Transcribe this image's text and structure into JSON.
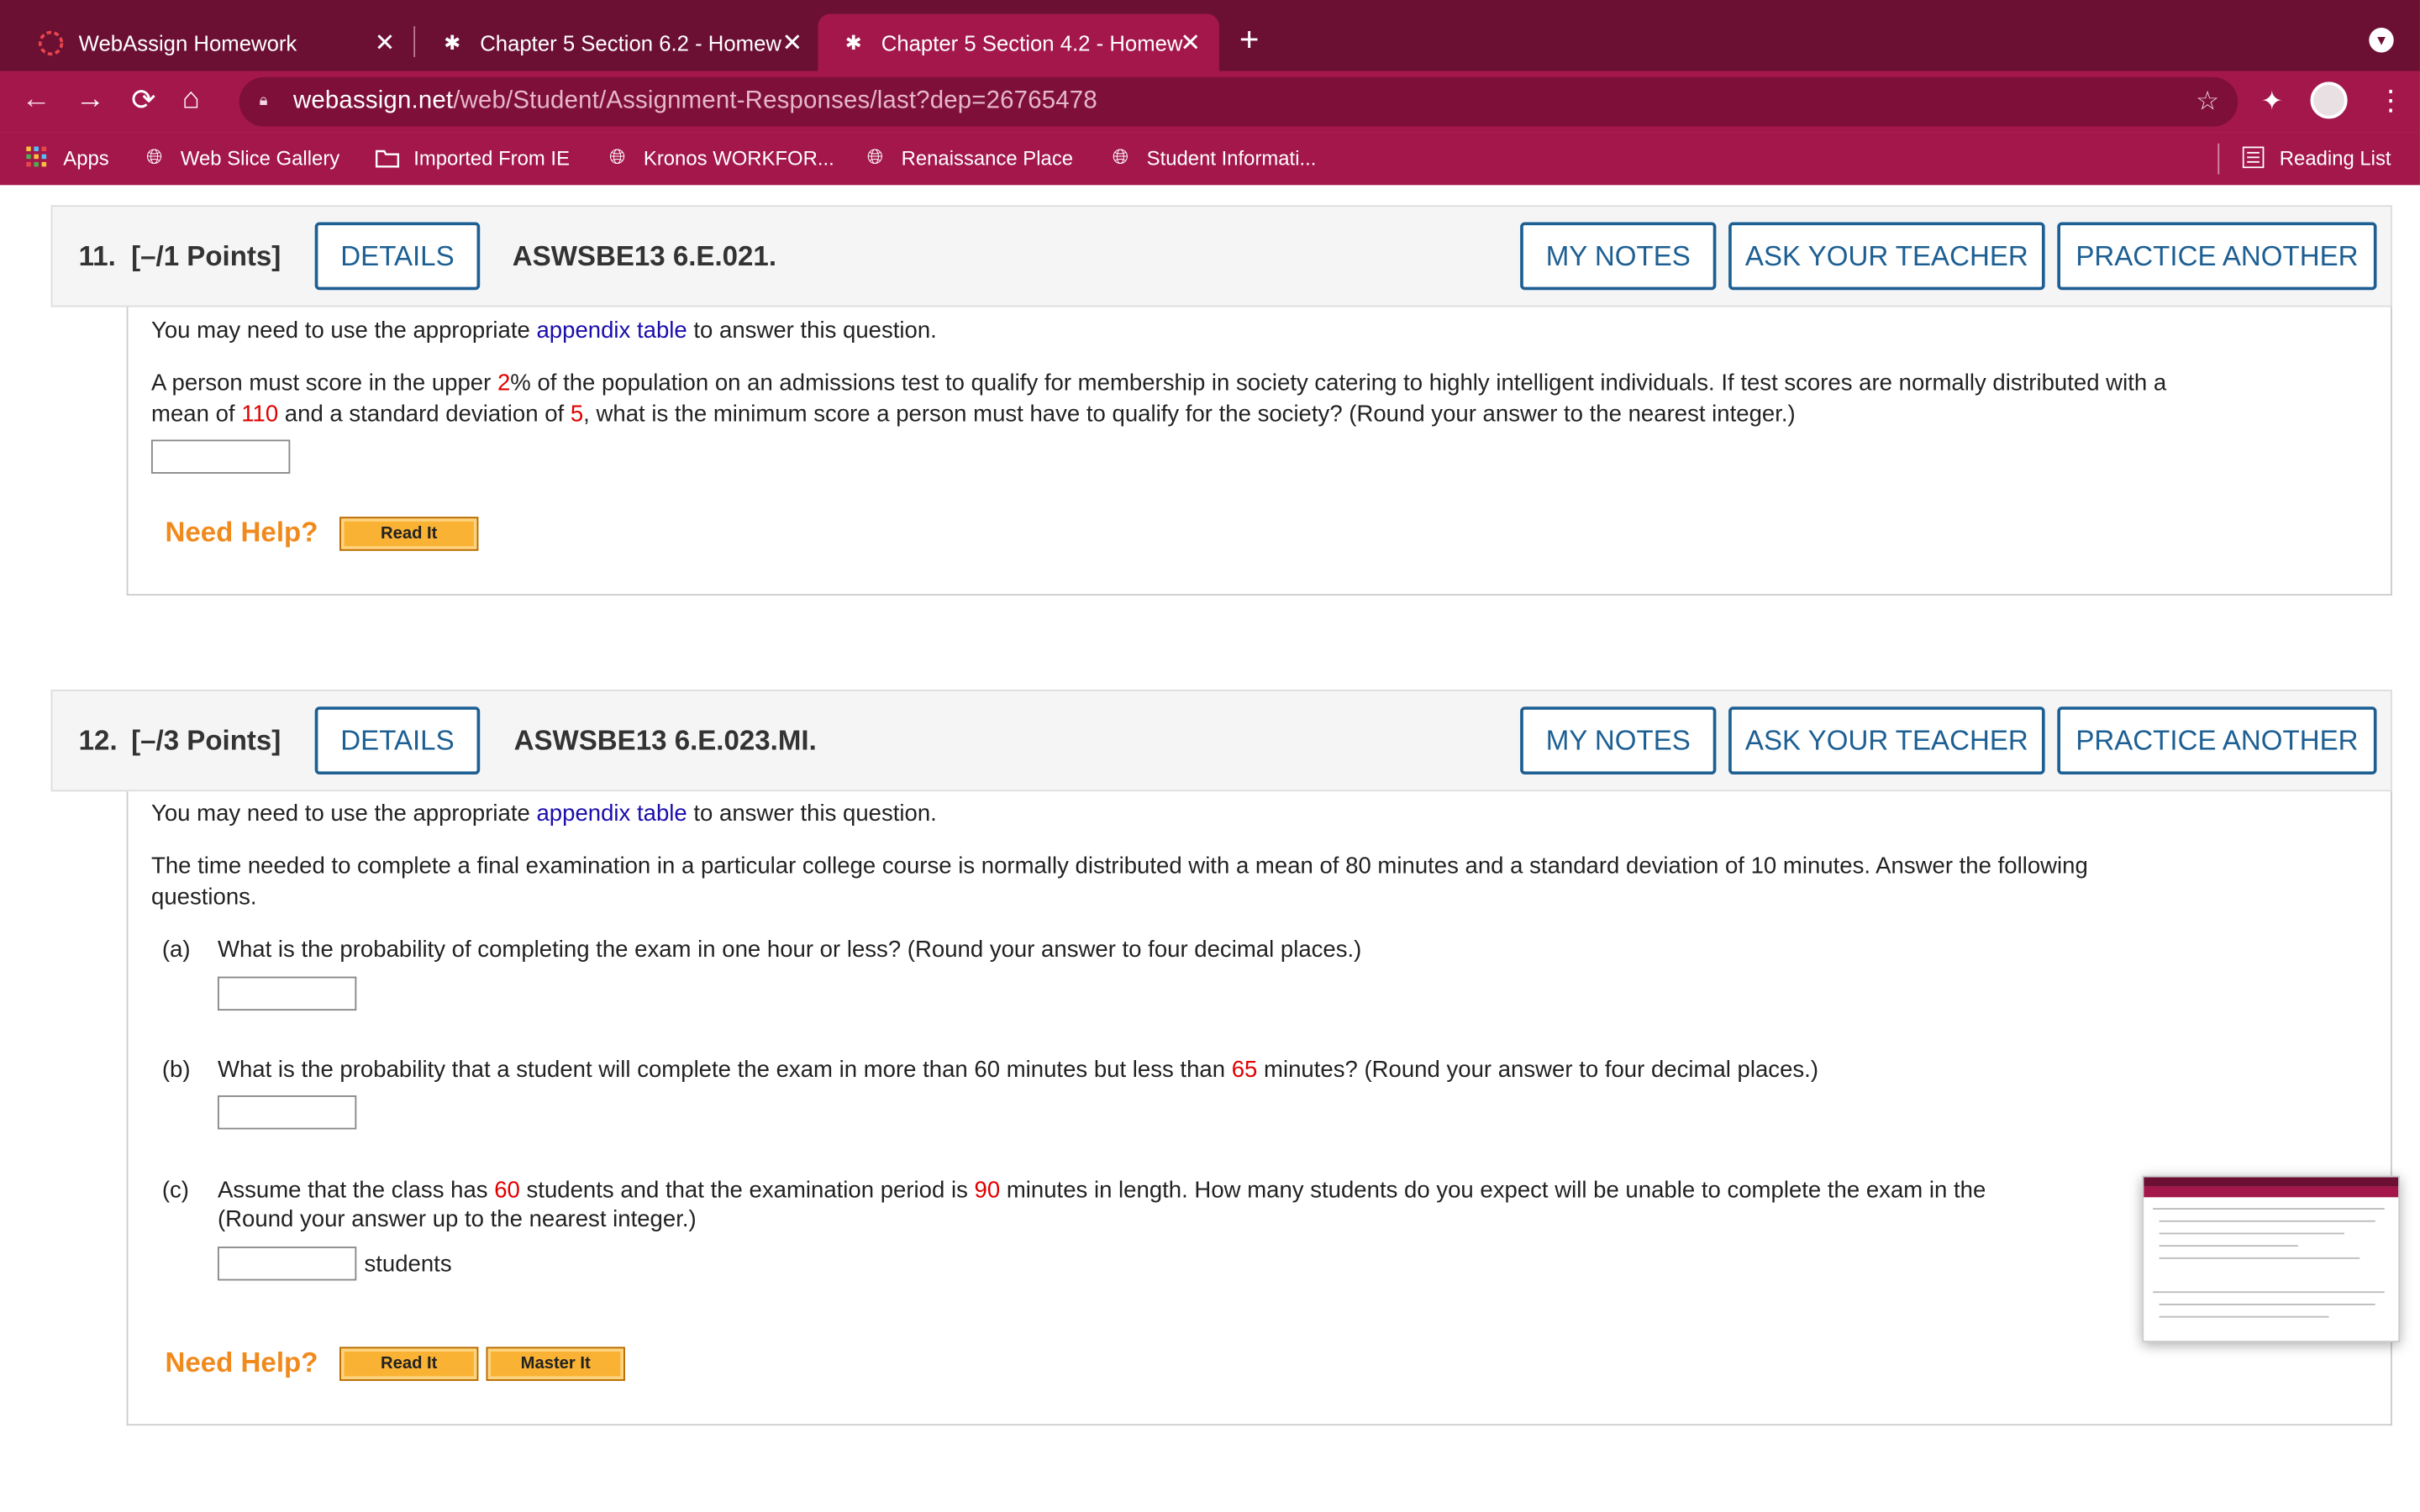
{
  "browser": {
    "tabs": [
      {
        "title": "WebAssign Homework",
        "icon": "webassign-icon"
      },
      {
        "title": "Chapter 5 Section 6.2 - Homew",
        "icon": "webassign-mascot-icon"
      },
      {
        "title": "Chapter 5 Section 4.2 - Homew",
        "icon": "webassign-mascot-icon"
      }
    ],
    "url_host": "webassign.net",
    "url_path": "/web/Student/Assignment-Responses/last?dep=26765478",
    "bookmarks": [
      {
        "label": "Apps",
        "icon": "apps-grid-icon"
      },
      {
        "label": "Web Slice Gallery",
        "icon": "globe-icon"
      },
      {
        "label": "Imported From IE",
        "icon": "folder-icon"
      },
      {
        "label": "Kronos WORKFOR...",
        "icon": "globe-icon"
      },
      {
        "label": "Renaissance Place",
        "icon": "globe-icon"
      },
      {
        "label": "Student Informati...",
        "icon": "globe-icon"
      }
    ],
    "reading_list": "Reading List"
  },
  "buttons": {
    "details": "DETAILS",
    "my_notes": "MY NOTES",
    "ask_teacher": "ASK YOUR TEACHER",
    "practice_another": "PRACTICE ANOTHER",
    "read_it": "Read It",
    "master_it": "Master It",
    "need_help": "Need Help?"
  },
  "q11": {
    "number": "11.",
    "points": "[–/1 Points]",
    "code": "ASWSBE13 6.E.021.",
    "appendix_pre": "You may need to use the appropriate ",
    "appendix_link": "appendix table",
    "appendix_post": " to answer this question.",
    "text_1": "A person must score in the upper ",
    "v_pct": "2",
    "text_2": "% of the population on an admissions test to qualify for membership in society catering to highly intelligent individuals. If test scores are normally distributed with a",
    "text_3": "mean of ",
    "v_mean": "110",
    "text_4": " and a standard deviation of ",
    "v_sd": "5",
    "text_5": ", what is the minimum score a person must have to qualify for the society? (Round your answer to the nearest integer.)"
  },
  "q12": {
    "number": "12.",
    "points": "[–/3 Points]",
    "code": "ASWSBE13 6.E.023.MI.",
    "appendix_pre": "You may need to use the appropriate ",
    "appendix_link": "appendix table",
    "appendix_post": " to answer this question.",
    "intro_1": "The time needed to complete a final examination in a particular college course is normally distributed with a mean of 80 minutes and a standard deviation of 10 minutes. Answer the following",
    "intro_2": "questions.",
    "a_label": "(a)",
    "a_text": "What is the probability of completing the exam in one hour or less? (Round your answer to four decimal places.)",
    "b_label": "(b)",
    "b_text_1": "What is the probability that a student will complete the exam in more than 60 minutes but less than ",
    "b_val": "65",
    "b_text_2": " minutes? (Round your answer to four decimal places.)",
    "c_label": "(c)",
    "c_text_1": "Assume that the class has ",
    "c_val_students": "60",
    "c_text_2": " students and that the examination period is ",
    "c_val_minutes": "90",
    "c_text_3": " minutes in length. How many students do you expect will be unable to complete the exam in the",
    "c_text_4": "(Round your answer up to the nearest integer.)",
    "c_unit": "students"
  }
}
